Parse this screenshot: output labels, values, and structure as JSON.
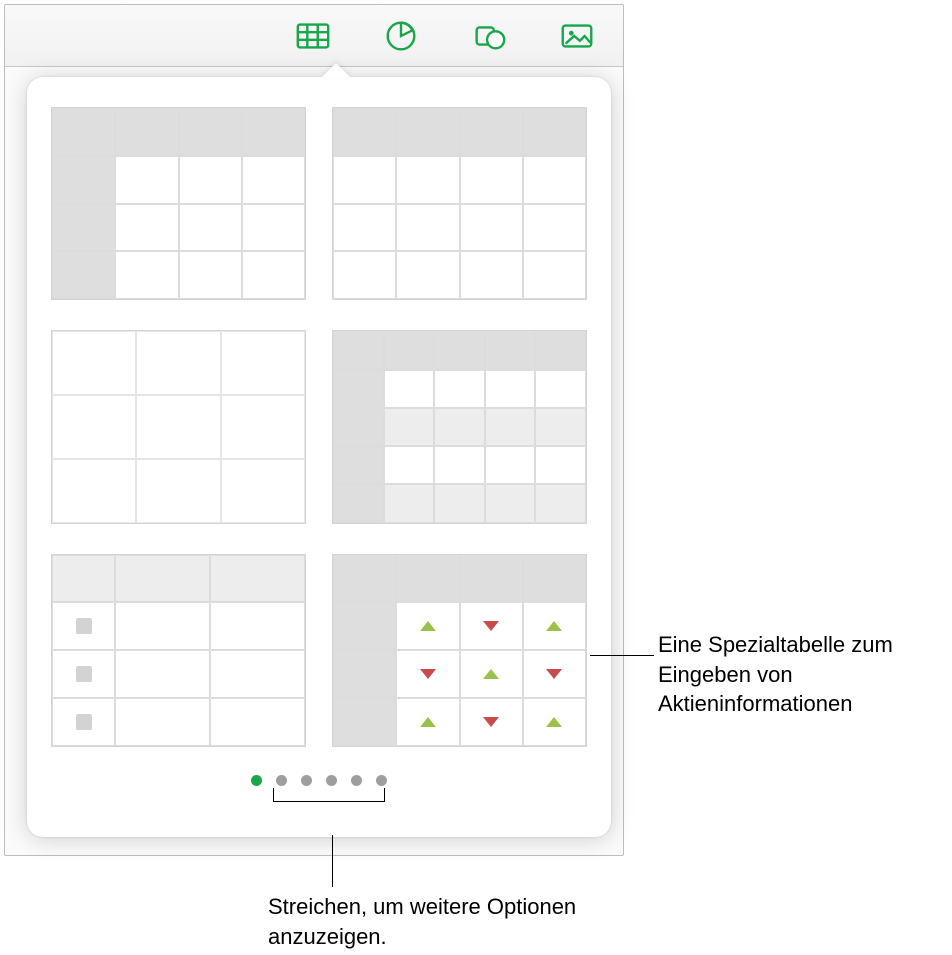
{
  "toolbar": {
    "table_btn": "table-tool",
    "chart_btn": "chart-tool",
    "shape_btn": "shape-tool",
    "media_btn": "media-tool"
  },
  "popover": {
    "templates": [
      "header-row-col",
      "header-row-only",
      "plain-grid",
      "banded-header",
      "checklist",
      "stock-arrows"
    ],
    "pager": {
      "page_count": 6,
      "active_index": 0
    }
  },
  "callouts": {
    "stock": "Eine Spezialtabelle zum Eingeben von Aktieninformationen",
    "swipe": "Streichen, um weitere Optionen anzuzeigen."
  },
  "colors": {
    "accent": "#17a64a",
    "up_arrow": "#9ac24a",
    "down_arrow": "#c94b4b"
  }
}
